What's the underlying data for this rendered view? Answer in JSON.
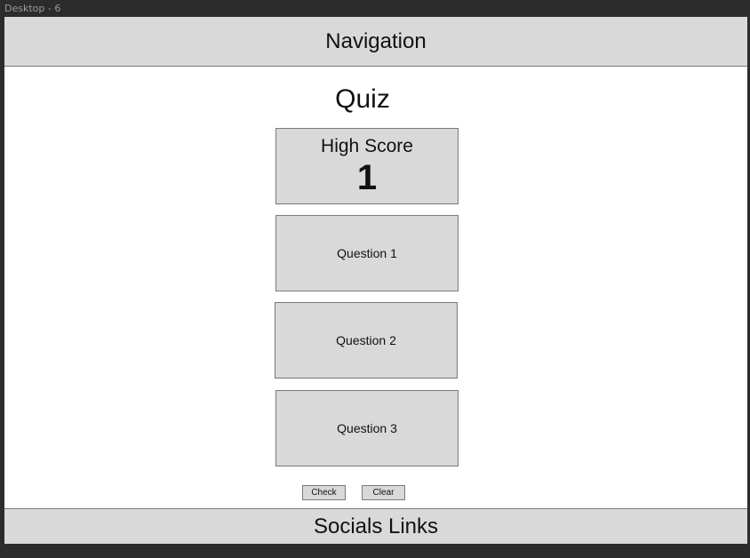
{
  "canvas": {
    "frame_label": "Desktop - 6"
  },
  "header": {
    "navigation_label": "Navigation"
  },
  "main": {
    "title": "Quiz",
    "high_score": {
      "label": "High Score",
      "value": "1"
    },
    "questions": [
      {
        "label": "Question 1"
      },
      {
        "label": "Question 2"
      },
      {
        "label": "Question 3"
      }
    ],
    "buttons": {
      "check_label": "Check",
      "clear_label": "Clear"
    }
  },
  "footer": {
    "socials_label": "Socials Links"
  },
  "colors": {
    "canvas_background": "#2c2c2c",
    "frame_background": "#ffffff",
    "placeholder_fill": "#d9d9d9",
    "placeholder_stroke": "#7a7a7a"
  }
}
